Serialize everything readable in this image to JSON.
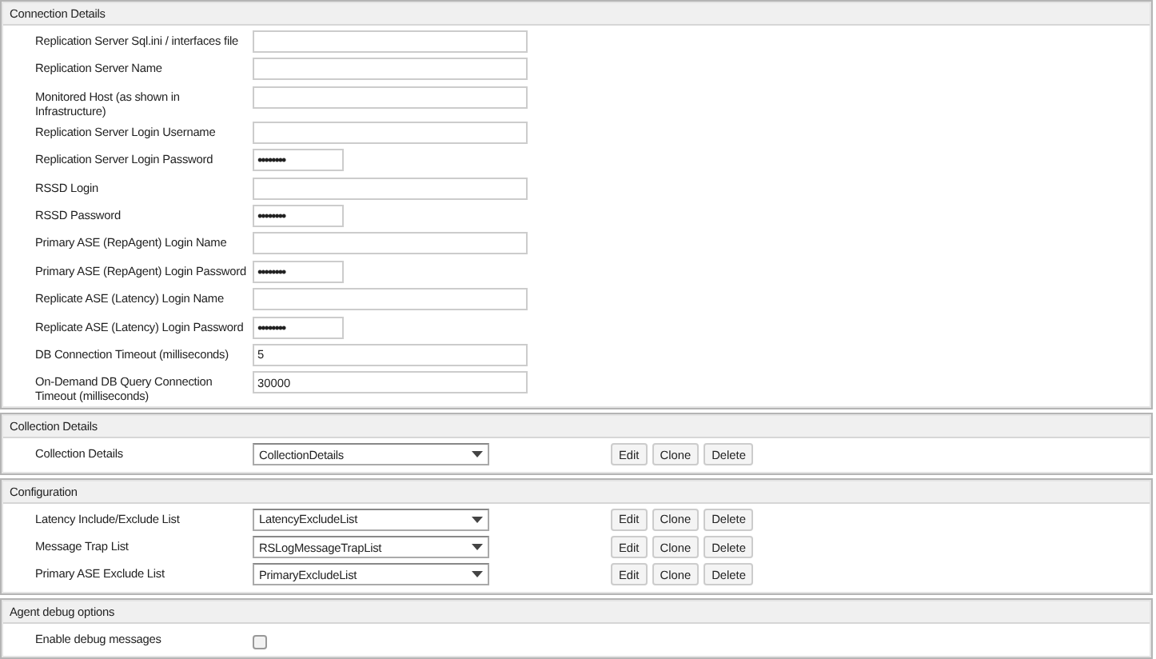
{
  "sections": [
    {
      "title": "Connection Details",
      "kind": "fields",
      "rows": [
        {
          "label": "Replication Server Sql.ini / interfaces file",
          "kind": "text",
          "value": ""
        },
        {
          "label": "Replication Server Name",
          "kind": "text",
          "value": ""
        },
        {
          "label": "Monitored Host (as shown in Infrastructure)",
          "kind": "text",
          "value": ""
        },
        {
          "label": "Replication Server Login Username",
          "kind": "text",
          "value": ""
        },
        {
          "label": "Replication Server Login Password",
          "kind": "password",
          "value": "••••••••"
        },
        {
          "label": "RSSD Login",
          "kind": "text",
          "value": ""
        },
        {
          "label": "RSSD Password",
          "kind": "password",
          "value": "••••••••"
        },
        {
          "label": "Primary ASE (RepAgent) Login Name",
          "kind": "text",
          "value": ""
        },
        {
          "label": "Primary ASE (RepAgent) Login Password",
          "kind": "password",
          "value": "••••••••"
        },
        {
          "label": "Replicate ASE (Latency) Login Name",
          "kind": "text",
          "value": ""
        },
        {
          "label": "Replicate ASE (Latency) Login Password",
          "kind": "password",
          "value": "••••••••"
        },
        {
          "label": "DB Connection Timeout (milliseconds)",
          "kind": "text",
          "value": "5"
        },
        {
          "label": "On-Demand DB Query Connection Timeout (milliseconds)",
          "kind": "text",
          "value": "30000"
        }
      ]
    },
    {
      "title": "Collection Details",
      "kind": "selects",
      "rows": [
        {
          "label": "Collection Details",
          "value": "CollectionDetails",
          "buttons": [
            "Edit",
            "Clone",
            "Delete"
          ]
        }
      ]
    },
    {
      "title": "Configuration",
      "kind": "selects",
      "rows": [
        {
          "label": "Latency Include/Exclude List",
          "value": "LatencyExcludeList",
          "buttons": [
            "Edit",
            "Clone",
            "Delete"
          ]
        },
        {
          "label": "Message Trap List",
          "value": "RSLogMessageTrapList",
          "buttons": [
            "Edit",
            "Clone",
            "Delete"
          ]
        },
        {
          "label": "Primary ASE Exclude List",
          "value": "PrimaryExcludeList",
          "buttons": [
            "Edit",
            "Clone",
            "Delete"
          ]
        }
      ]
    },
    {
      "title": "Agent debug options",
      "kind": "checks",
      "rows": [
        {
          "label": "Enable debug messages",
          "checked": false
        }
      ]
    }
  ]
}
